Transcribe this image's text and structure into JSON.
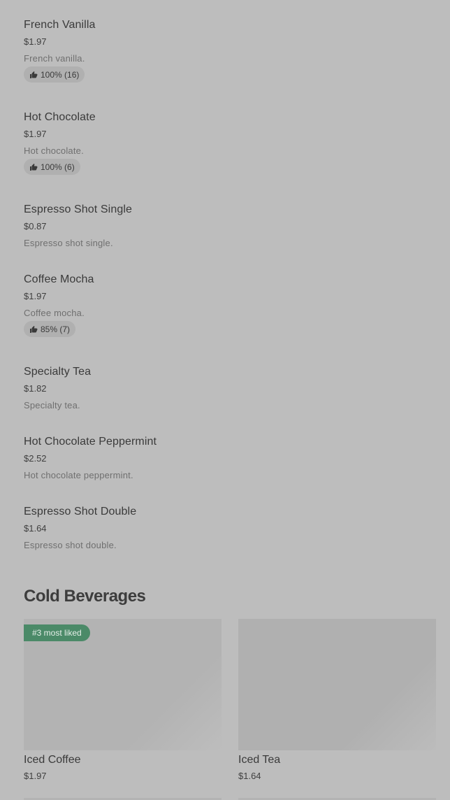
{
  "menu_items": [
    {
      "name": "French Vanilla",
      "price": "$1.97",
      "description": "French vanilla.",
      "rating": "100% (16)"
    },
    {
      "name": "Hot Chocolate",
      "price": "$1.97",
      "description": "Hot chocolate.",
      "rating": "100% (6)"
    },
    {
      "name": "Espresso Shot Single",
      "price": "$0.87",
      "description": "Espresso shot single."
    },
    {
      "name": "Coffee Mocha",
      "price": "$1.97",
      "description": "Coffee mocha.",
      "rating": "85% (7)"
    },
    {
      "name": "Specialty Tea",
      "price": "$1.82",
      "description": "Specialty tea."
    },
    {
      "name": "Hot Chocolate Peppermint",
      "price": "$2.52",
      "description": "Hot chocolate peppermint."
    },
    {
      "name": "Espresso Shot Double",
      "price": "$1.64",
      "description": "Espresso shot double."
    }
  ],
  "cold_section": {
    "title": "Cold Beverages",
    "cards": [
      {
        "name": "Iced Coffee",
        "price": "$1.97",
        "badge": "#3 most liked"
      },
      {
        "name": "Iced Tea",
        "price": "$1.64"
      }
    ]
  },
  "colors": {
    "background": "#bdbdbd",
    "badge_green": "#4b8a68",
    "rating_pill": "#b0b0b0"
  },
  "icons": {
    "rating": "thumbs-up-icon"
  }
}
